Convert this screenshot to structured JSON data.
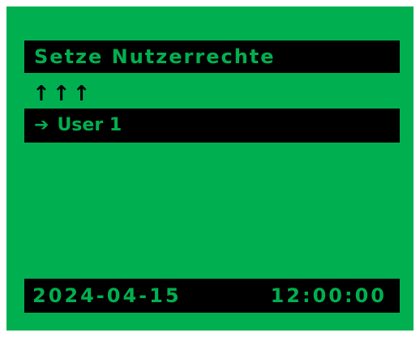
{
  "screen": {
    "background_color": "#00b050",
    "bar_color": "#000000",
    "title": "Setze Nutzerrechte",
    "nav_arrows": "↑↑↑",
    "nav_arrows_icon": "up-arrow-icon",
    "selected_item": {
      "arrow": "➔",
      "arrow_icon": "right-arrow-icon",
      "label": "User 1"
    },
    "status": {
      "date": "2024-04-15",
      "time": "12:00:00"
    }
  }
}
